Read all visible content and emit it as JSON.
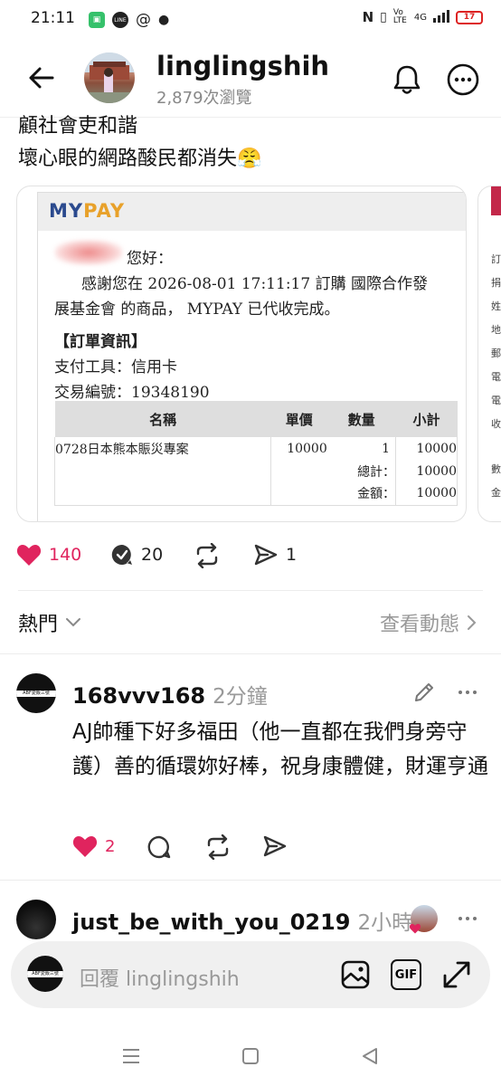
{
  "status_bar": {
    "time": "21:11",
    "network": "4G",
    "volte": "Vo LTE",
    "battery": "17",
    "app_icons": [
      "chat-icon",
      "line-icon",
      "threads-icon",
      "dot-icon"
    ],
    "line_label": "LINE"
  },
  "header": {
    "username": "linglingshih",
    "views": "2,879次瀏覽"
  },
  "post": {
    "line1": "顧社會吏和諧",
    "line2": "壞心眼的網路酸民都消失😤"
  },
  "receipt": {
    "logo_my": "MY",
    "logo_pay": "PAY",
    "greeting": "您好：",
    "body_line1": "感謝您在 2026-08-01 17:11:17 訂購 國際合作發",
    "body_line2": "展基金會 的商品， MYPAY 已代收完成。",
    "section_title": "【訂單資訊】",
    "pay_tool": "支付工具：信用卡",
    "txn_no": "交易編號：19348190",
    "table_headers": [
      "名稱",
      "單價",
      "數量",
      "小計"
    ],
    "item": {
      "name": "0728日本熊本賑災專案",
      "price": "10000",
      "qty": "1",
      "subtotal": "10000"
    },
    "total_label": "總計：",
    "total_value": "10000",
    "amount_label": "金額：",
    "amount_value": "10000",
    "peek_chars": [
      "訂",
      "捐",
      "姓",
      "地",
      "郵",
      "電",
      "電",
      "收",
      "數",
      "金"
    ]
  },
  "actions": {
    "likes": "140",
    "comments": "20",
    "shares": "1"
  },
  "sort": {
    "label": "熱門",
    "activity": "查看動態"
  },
  "comments": [
    {
      "username": "168vvv168",
      "time": "2分鐘",
      "text": "AJ帥種下好多福田（他一直都在我們身旁守護）善的循環妳好棒，祝身康體健，財運亨通",
      "likes": "2",
      "avatar_text": "ABF愛飯三號"
    },
    {
      "username": "just_be_with_you_0219",
      "time": "2小時"
    }
  ],
  "reply": {
    "placeholder": "回覆 linglingshih",
    "gif_label": "GIF",
    "avatar_text": "ABF愛飯三號"
  },
  "colors": {
    "like_red": "#e0245e",
    "mypay_blue": "#2b4a8e",
    "mypay_orange": "#e8a12a"
  }
}
